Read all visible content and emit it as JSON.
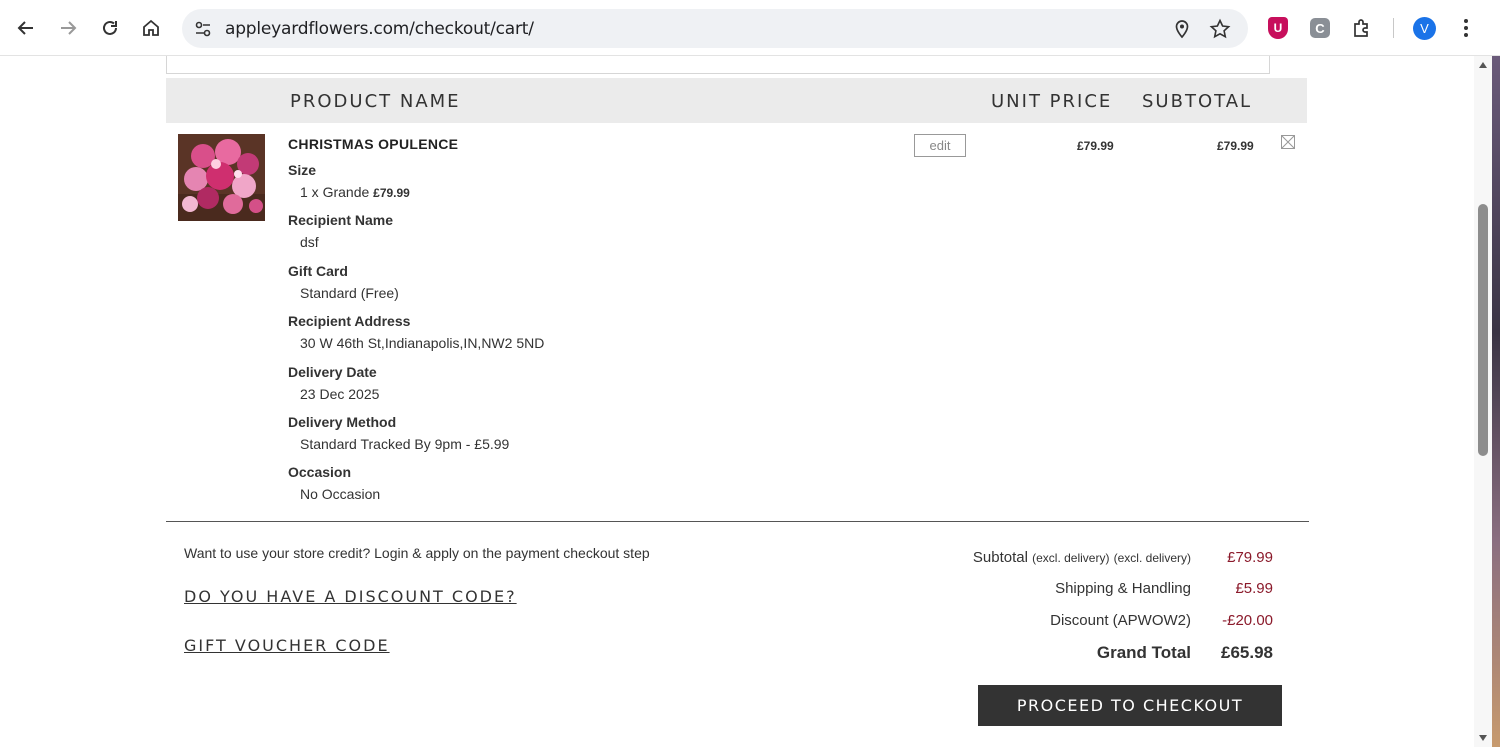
{
  "browser": {
    "url": "appleyardflowers.com/checkout/cart/",
    "profile_initial": "V",
    "ext_ublock": "U",
    "ext_c": "C"
  },
  "table": {
    "col_product": "PRODUCT NAME",
    "col_unit_price": "UNIT PRICE",
    "col_subtotal": "SUBTOTAL"
  },
  "item": {
    "name": "CHRISTMAS OPULENCE",
    "edit_label": "edit",
    "unit_price": "£79.99",
    "subtotal": "£79.99",
    "options": [
      {
        "label": "Size",
        "value": "1 x Grande",
        "value_price": "£79.99"
      },
      {
        "label": "Recipient Name",
        "value": "dsf"
      },
      {
        "label": "Gift Card",
        "value": "Standard (Free)"
      },
      {
        "label": "Recipient Address",
        "value": "30 W 46th St,Indianapolis,IN,NW2 5ND"
      },
      {
        "label": "Delivery Date",
        "value": "23 Dec 2025"
      },
      {
        "label": "Delivery Method",
        "value": "Standard Tracked By 9pm - £5.99"
      },
      {
        "label": "Occasion",
        "value": "No Occasion"
      }
    ]
  },
  "footer": {
    "credit_text": "Want to use your store credit? Login & apply on the payment checkout step",
    "discount_link": "DO YOU HAVE A DISCOUNT CODE?",
    "voucher_link": "GIFT VOUCHER CODE"
  },
  "totals": {
    "subtotal_label": "Subtotal",
    "subtotal_note_1": "(excl. delivery)",
    "subtotal_note_2": "(excl. delivery)",
    "subtotal_value": "£79.99",
    "shipping_label": "Shipping & Handling",
    "shipping_value": "£5.99",
    "discount_label": "Discount (APWOW2)",
    "discount_value": "-£20.00",
    "grand_label": "Grand Total",
    "grand_value": "£65.98"
  },
  "checkout_button": "PROCEED TO CHECKOUT",
  "colors": {
    "price_accent": "#8b1a2b",
    "button_bg": "#333333",
    "header_bg": "#ebebeb"
  }
}
